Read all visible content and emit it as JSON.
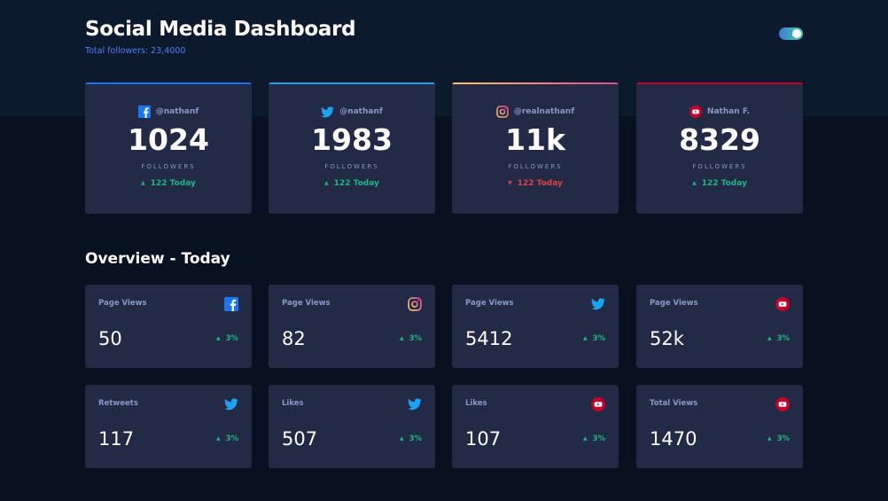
{
  "header": {
    "title": "Social Media Dashboard",
    "total_followers": "Total followers: 23,4000",
    "dark_mode_toggle": "on"
  },
  "colors": {
    "facebook": "#1877f2",
    "twitter": "#1da1f2",
    "instagram_gradient": [
      "#fdc468",
      "#df4996"
    ],
    "youtube": "#c4032a",
    "up": "#1db489",
    "down": "#dc414c",
    "card": "#222a45",
    "background": "#08111f"
  },
  "followers": [
    {
      "platform": "facebook",
      "icon": "facebook-icon",
      "handle": "@nathanf",
      "count": "1024",
      "label": "FOLLOWERS",
      "today": "122 Today",
      "trend": "up"
    },
    {
      "platform": "twitter",
      "icon": "twitter-icon",
      "handle": "@nathanf",
      "count": "1983",
      "label": "FOLLOWERS",
      "today": "122 Today",
      "trend": "up"
    },
    {
      "platform": "instagram",
      "icon": "instagram-icon",
      "handle": "@realnathanf",
      "count": "11k",
      "label": "FOLLOWERS",
      "today": "122 Today",
      "trend": "down"
    },
    {
      "platform": "youtube",
      "icon": "youtube-icon",
      "handle": "Nathan F.",
      "count": "8329",
      "label": "FOLLOWERS",
      "today": "122 Today",
      "trend": "up"
    }
  ],
  "overview": {
    "title": "Overview - Today",
    "cards": [
      {
        "metric": "Page Views",
        "icon": "facebook-icon",
        "value": "50",
        "change": "3%"
      },
      {
        "metric": "Page Views",
        "icon": "instagram-icon",
        "value": "82",
        "change": "3%"
      },
      {
        "metric": "Page Views",
        "icon": "twitter-icon",
        "value": "5412",
        "change": "3%"
      },
      {
        "metric": "Page Views",
        "icon": "youtube-icon",
        "value": "52k",
        "change": "3%"
      },
      {
        "metric": "Retweets",
        "icon": "twitter-icon",
        "value": "117",
        "change": "3%"
      },
      {
        "metric": "Likes",
        "icon": "twitter-icon",
        "value": "507",
        "change": "3%"
      },
      {
        "metric": "Likes",
        "icon": "youtube-icon",
        "value": "107",
        "change": "3%"
      },
      {
        "metric": "Total Views",
        "icon": "youtube-icon",
        "value": "1470",
        "change": "3%"
      }
    ]
  }
}
